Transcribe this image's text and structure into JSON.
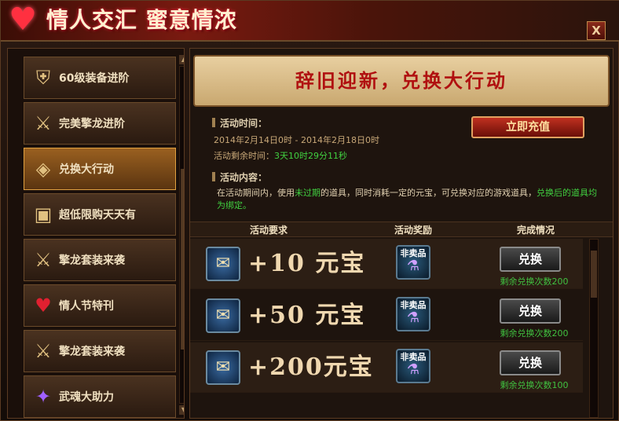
{
  "window": {
    "title": "情人交汇 蜜意情浓",
    "close_label": "X"
  },
  "sidebar": {
    "items": [
      {
        "label": "60级装备进阶",
        "icon": "armor-icon"
      },
      {
        "label": "完美擎龙进阶",
        "icon": "robe-icon"
      },
      {
        "label": "兑换大行动",
        "icon": "gold-ingot-icon"
      },
      {
        "label": "超低限购天天有",
        "icon": "gift-box-icon"
      },
      {
        "label": "擎龙套装来袭",
        "icon": "robe-icon"
      },
      {
        "label": "情人节特刊",
        "icon": "heart-icon"
      },
      {
        "label": "擎龙套装来袭",
        "icon": "robe-icon"
      },
      {
        "label": "武魂大助力",
        "icon": "flame-icon"
      }
    ],
    "active_index": 2
  },
  "main": {
    "banner_title": "辞旧迎新，兑换大行动",
    "recharge_label": "立即充值",
    "time_section": "活动时间：",
    "time_range": "2014年2月14日0时 - 2014年2月18日0时",
    "remaining_label": "活动剩余时间：",
    "remaining_value": "3天10时29分11秒",
    "content_section": "活动内容：",
    "desc_part1": "在活动期间内，使用",
    "desc_highlight": "未过期",
    "desc_part2": "的道具，同时消耗一定的元宝，可兑换对应的游戏道具，",
    "desc_green": "兑换后的道具均为绑定。",
    "table_headers": [
      "活动要求",
      "活动奖励",
      "完成情况"
    ],
    "rows": [
      {
        "requirement": "+10 元宝",
        "reward_tag": "非卖品",
        "button": "兑换",
        "remaining": "剩余兑换次数200"
      },
      {
        "requirement": "+50 元宝",
        "reward_tag": "非卖品",
        "button": "兑换",
        "remaining": "剩余兑换次数200"
      },
      {
        "requirement": "+200元宝",
        "reward_tag": "非卖品",
        "button": "兑换",
        "remaining": "剩余兑换次数100"
      }
    ]
  }
}
